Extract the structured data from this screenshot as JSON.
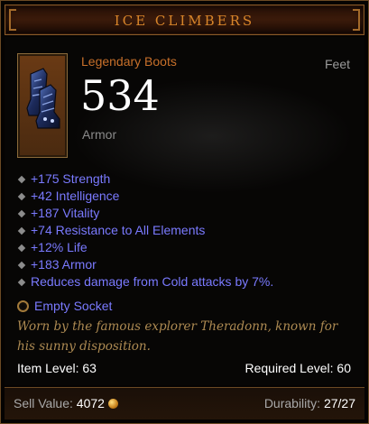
{
  "item": {
    "name": "ICE CLIMBERS",
    "type": "Legendary Boots",
    "slot": "Feet",
    "armor_value": "534",
    "armor_label": "Armor",
    "icon": "legendary-boots-icon"
  },
  "affixes": [
    "+175 Strength",
    "+42 Intelligence",
    "+187 Vitality",
    "+74 Resistance to All Elements",
    "+12% Life",
    "+183 Armor",
    "Reduces damage from Cold attacks by 7%."
  ],
  "socket": {
    "label": "Empty Socket"
  },
  "flavor_text": "Worn by the famous explorer Theradonn, known for his sunny disposition.",
  "levels": {
    "item_level": "Item Level: 63",
    "required_level": "Required Level: 60"
  },
  "footer": {
    "sell_label": "Sell Value:",
    "sell_value": "4072",
    "durability_label": "Durability:",
    "durability_value": "27/27"
  },
  "colors": {
    "title": "#d8852a",
    "item_type": "#c8702a",
    "affix": "#7a7aff",
    "flavor": "#ad8a52",
    "border": "#6b4a24"
  }
}
